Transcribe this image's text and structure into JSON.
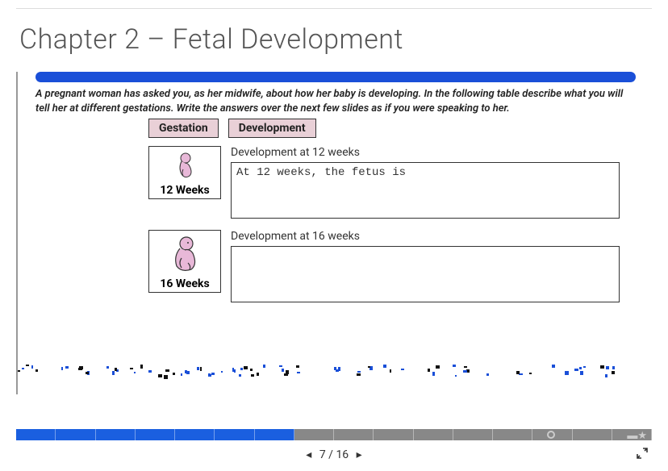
{
  "chapter": {
    "title": "Chapter 2 – Fetal Development"
  },
  "instructions": "A pregnant woman has asked you, as her midwife, about how her baby is developing. In the following table describe what you will tell her at different gestations. Write the answers over the next few slides as if you were speaking to her.",
  "headers": {
    "gestation": "Gestation",
    "development": "Development"
  },
  "entries": [
    {
      "weeks_label": "12 Weeks",
      "dev_title": "Development at 12 weeks",
      "dev_text": "At 12 weeks, the fetus is"
    },
    {
      "weeks_label": "16 Weeks",
      "dev_title": "Development at 16 weeks",
      "dev_text": ""
    }
  ],
  "pager": {
    "prev": "◂",
    "next": "▸",
    "current": 7,
    "total": 16,
    "sep": "/"
  },
  "progress": {
    "total_segments": 16,
    "completed": 7
  }
}
